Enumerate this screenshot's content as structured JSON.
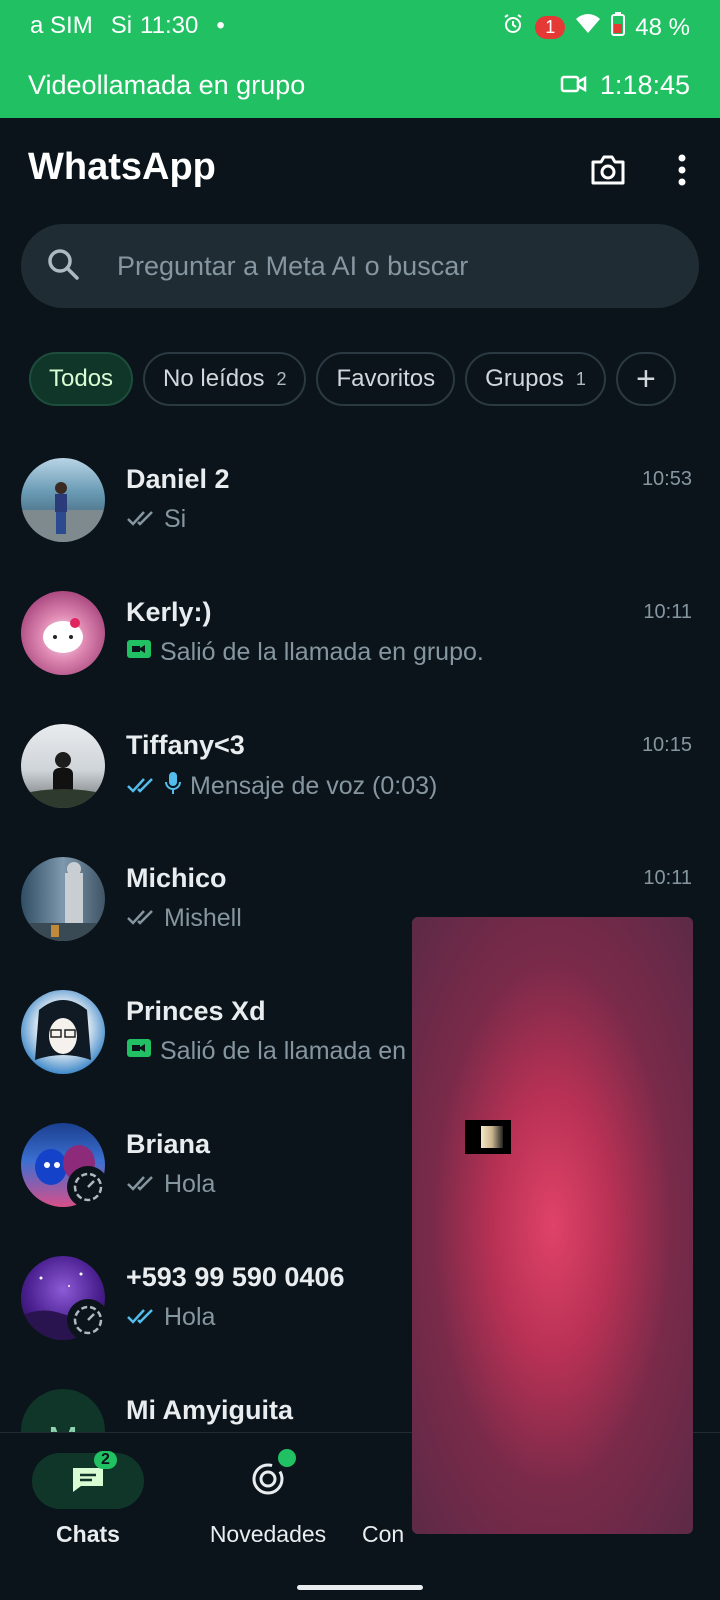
{
  "status_bar": {
    "sim1": "a SIM",
    "sim2": "Si",
    "time": "11:30",
    "dot": "•",
    "notif_count": "1",
    "battery": "48 %"
  },
  "call_banner": {
    "title": "Videollamada en grupo",
    "timer": "1:18:45",
    "icon": "video-icon"
  },
  "header": {
    "title": "WhatsApp",
    "camera_icon": "camera-icon",
    "menu_icon": "more-vertical-icon"
  },
  "search": {
    "placeholder": "Preguntar a Meta AI o buscar"
  },
  "filters": [
    {
      "label": "Todos",
      "count": ""
    },
    {
      "label": "No leídos",
      "count": "2"
    },
    {
      "label": "Favoritos",
      "count": ""
    },
    {
      "label": "Grupos",
      "count": "1"
    },
    {
      "label": "+",
      "count": ""
    }
  ],
  "chats": [
    {
      "name": "Daniel 2",
      "time": "10:53",
      "preview": "Si",
      "tick": "grey-double-check"
    },
    {
      "name": "Kerly:)",
      "time": "10:11",
      "preview": "Salió de la llamada en grupo.",
      "tick": "video-call"
    },
    {
      "name": "Tiffany<3",
      "time": "10:15",
      "preview": "Mensaje de voz (0:03)",
      "tick": "blue-double-check-mic"
    },
    {
      "name": "Michico",
      "time": "10:11",
      "preview": "Mishell",
      "tick": "grey-double-check"
    },
    {
      "name": "Princes Xd",
      "time": "",
      "preview": "Salió de la llamada en",
      "tick": "video-call"
    },
    {
      "name": "Briana",
      "time": "",
      "preview": "Hola",
      "tick": "grey-double-check"
    },
    {
      "name": "+593 99 590 0406",
      "time": "",
      "preview": "Hola",
      "tick": "blue-double-check"
    },
    {
      "name": "Mi Amyiguita",
      "time": "",
      "preview": "",
      "tick": "",
      "initial": "M"
    }
  ],
  "bottom_nav": {
    "chats_label": "Chats",
    "chats_badge": "2",
    "updates_label": "Novedades",
    "communities_label": "Con"
  },
  "colors": {
    "accent": "#21c063",
    "background": "#0b141a",
    "search_bg": "#202c33",
    "chip_active_bg": "#103529",
    "blue_tick": "#53bdeb"
  }
}
